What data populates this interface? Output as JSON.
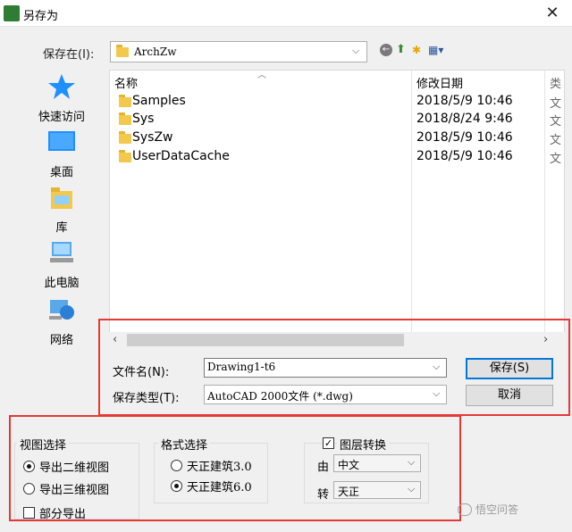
{
  "window": {
    "title": "另存为",
    "close_glyph": "✕"
  },
  "save_in": {
    "label": "保存在(I):",
    "value": "ArchZw"
  },
  "toolbar": {
    "back_icon": "back-arrow-icon",
    "up_icon": "up-folder-icon",
    "new_folder_icon": "new-folder-icon",
    "view_icon": "view-menu-icon"
  },
  "places": [
    {
      "label": "快速访问",
      "icon": "star-icon"
    },
    {
      "label": "桌面",
      "icon": "desktop-icon"
    },
    {
      "label": "库",
      "icon": "library-icon"
    },
    {
      "label": "此电脑",
      "icon": "computer-icon"
    },
    {
      "label": "网络",
      "icon": "network-icon"
    }
  ],
  "filelist": {
    "columns": {
      "name": "名称",
      "date": "修改日期",
      "extra": "类"
    },
    "rows": [
      {
        "name": "Samples",
        "date": "2018/5/9 10:46",
        "extra": "文"
      },
      {
        "name": "Sys",
        "date": "2018/8/24 9:46",
        "extra": "文"
      },
      {
        "name": "SysZw",
        "date": "2018/5/9 10:46",
        "extra": "文"
      },
      {
        "name": "UserDataCache",
        "date": "2018/5/9 10:46",
        "extra": "文"
      }
    ]
  },
  "filename": {
    "label": "文件名(N):",
    "value": "Drawing1-t6"
  },
  "filetype": {
    "label": "保存类型(T):",
    "value": "AutoCAD 2000文件 (*.dwg)"
  },
  "buttons": {
    "save": "保存(S)",
    "cancel": "取消"
  },
  "view_group": {
    "title": "视图选择",
    "options": [
      {
        "label": "导出二维视图",
        "selected": true
      },
      {
        "label": "导出三维视图",
        "selected": false
      }
    ],
    "partial_export": {
      "label": "部分导出",
      "checked": false
    }
  },
  "format_group": {
    "title": "格式选择",
    "options": [
      {
        "label": "天正建筑3.0",
        "selected": false
      },
      {
        "label": "天正建筑6.0",
        "selected": true
      }
    ]
  },
  "layer_group": {
    "title": "图层转换",
    "checked": true,
    "from_label": "由",
    "from_value": "中文",
    "to_label": "转",
    "to_value": "天正"
  },
  "watermark": "悟空问答",
  "colors": {
    "highlight": "#e53935",
    "accent": "#0078d7",
    "folder": "#f2c94c"
  }
}
